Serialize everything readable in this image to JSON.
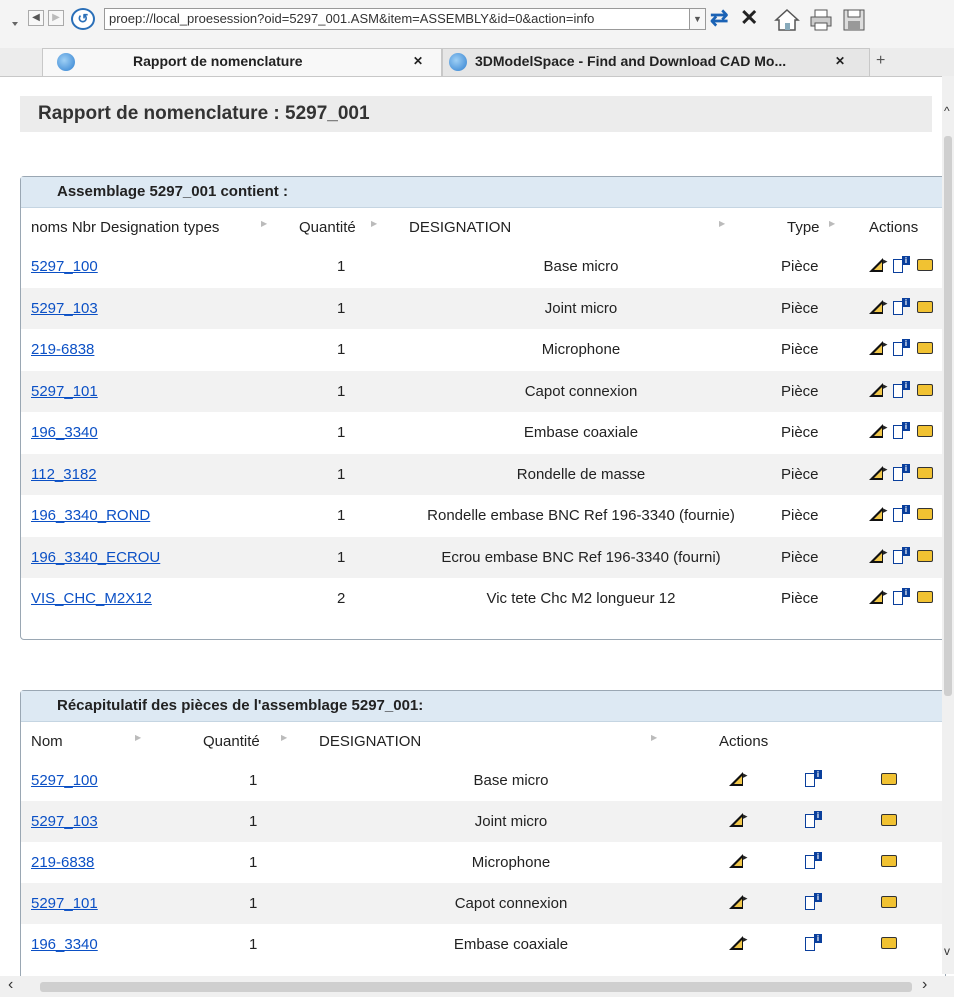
{
  "browser": {
    "url": "proep://local_proesession?oid=5297_001.ASM&item=ASSEMBLY&id=0&action=info",
    "tabs": [
      {
        "label": "Rapport de nomenclature",
        "close": "✕"
      },
      {
        "label": "3DModelSpace - Find and Download CAD Mo...",
        "close": "✕"
      }
    ],
    "new_tab": "+"
  },
  "page": {
    "title": "Rapport de nomenclature : 5297_001"
  },
  "bom_table": {
    "heading": "Assemblage 5297_001 contient :",
    "columns": [
      "noms Nbr Designation types",
      "Quantité",
      "DESIGNATION",
      "Type",
      "Actions"
    ],
    "rows": [
      {
        "name": "5297_100",
        "qty": "1",
        "designation": "Base micro",
        "type": "Pièce"
      },
      {
        "name": "5297_103",
        "qty": "1",
        "designation": "Joint micro",
        "type": "Pièce"
      },
      {
        "name": "219-6838",
        "qty": "1",
        "designation": "Microphone",
        "type": "Pièce"
      },
      {
        "name": "5297_101",
        "qty": "1",
        "designation": "Capot connexion",
        "type": "Pièce"
      },
      {
        "name": "196_3340",
        "qty": "1",
        "designation": "Embase coaxiale",
        "type": "Pièce"
      },
      {
        "name": "112_3182",
        "qty": "1",
        "designation": "Rondelle de masse",
        "type": "Pièce"
      },
      {
        "name": "196_3340_ROND",
        "qty": "1",
        "designation": "Rondelle embase BNC Ref 196-3340 (fournie)",
        "type": "Pièce"
      },
      {
        "name": "196_3340_ECROU",
        "qty": "1",
        "designation": "Ecrou embase BNC Ref 196-3340 (fourni)",
        "type": "Pièce"
      },
      {
        "name": "VIS_CHC_M2X12",
        "qty": "2",
        "designation": "Vic tete Chc M2 longueur 12",
        "type": "Pièce"
      }
    ]
  },
  "summary_table": {
    "heading": "Récapitulatif des pièces de l'assemblage 5297_001:",
    "columns": [
      "Nom",
      "Quantité",
      "DESIGNATION",
      "Actions"
    ],
    "rows": [
      {
        "name": "5297_100",
        "qty": "1",
        "designation": "Base micro"
      },
      {
        "name": "5297_103",
        "qty": "1",
        "designation": "Joint micro"
      },
      {
        "name": "219-6838",
        "qty": "1",
        "designation": "Microphone"
      },
      {
        "name": "5297_101",
        "qty": "1",
        "designation": "Capot connexion"
      },
      {
        "name": "196_3340",
        "qty": "1",
        "designation": "Embase coaxiale"
      }
    ]
  },
  "icons": [
    "back-icon",
    "forward-icon",
    "history-icon",
    "refresh-icon",
    "stop-icon",
    "home-icon",
    "print-icon",
    "save-icon",
    "open-model-icon",
    "info-doc-icon",
    "folder-icon"
  ],
  "colors": {
    "link": "#0b50c5",
    "panel_header": "#dde9f3",
    "row_alt": "#f2f2f2"
  }
}
